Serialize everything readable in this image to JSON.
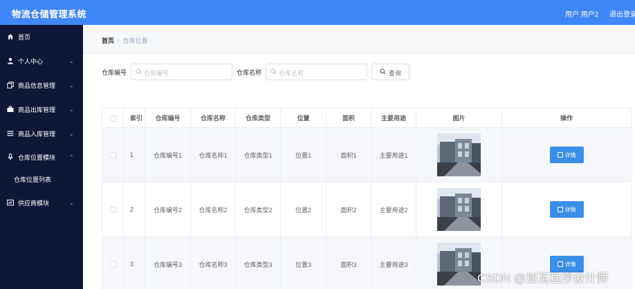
{
  "header": {
    "title": "物流仓储管理系统",
    "user": "用户 用户2",
    "logout": "退出登录"
  },
  "sidebar": {
    "items": [
      {
        "label": "首页",
        "icon": "home-icon"
      },
      {
        "label": "个人中心",
        "icon": "user-icon"
      },
      {
        "label": "商品信息管理",
        "icon": "copy-icon"
      },
      {
        "label": "商品出库管理",
        "icon": "suitcase-icon"
      },
      {
        "label": "商品入库管理",
        "icon": "list-icon"
      },
      {
        "label": "仓库位置模块",
        "icon": "microphone-icon"
      },
      {
        "label": "仓库位置列表",
        "icon": ""
      },
      {
        "label": "供应商模块",
        "icon": "dashboard-icon"
      }
    ]
  },
  "breadcrumb": {
    "home": "首页",
    "separator": "/",
    "current": "仓库位置"
  },
  "search": {
    "code_label": "仓库编号",
    "code_placeholder": "仓库编号",
    "name_label": "仓库名称",
    "name_placeholder": "仓库名称",
    "query_label": "查询"
  },
  "table": {
    "headers": [
      "索引",
      "仓库编号",
      "仓库名称",
      "仓库类型",
      "位置",
      "面积",
      "主要用途",
      "图片",
      "操作"
    ],
    "rows": [
      {
        "index": "1",
        "code": "仓库编号1",
        "name": "仓库名称1",
        "type": "仓库类型1",
        "location": "位置1",
        "area": "面积1",
        "usage": "主要用途1",
        "action": "详情"
      },
      {
        "index": "2",
        "code": "仓库编号2",
        "name": "仓库名称2",
        "type": "仓库类型2",
        "location": "位置2",
        "area": "面积2",
        "usage": "主要用途2",
        "action": "详情"
      },
      {
        "index": "3",
        "code": "仓库编号3",
        "name": "仓库名称3",
        "type": "仓库类型3",
        "location": "位置3",
        "area": "面积3",
        "usage": "主要用途3",
        "action": "详情"
      }
    ]
  },
  "watermark": "CSDN @加瓦程序设计师",
  "colors": {
    "header_bg": "#3f86f6",
    "sidebar_bg": "#0f1737",
    "detail_button": "#3a8ee6"
  }
}
